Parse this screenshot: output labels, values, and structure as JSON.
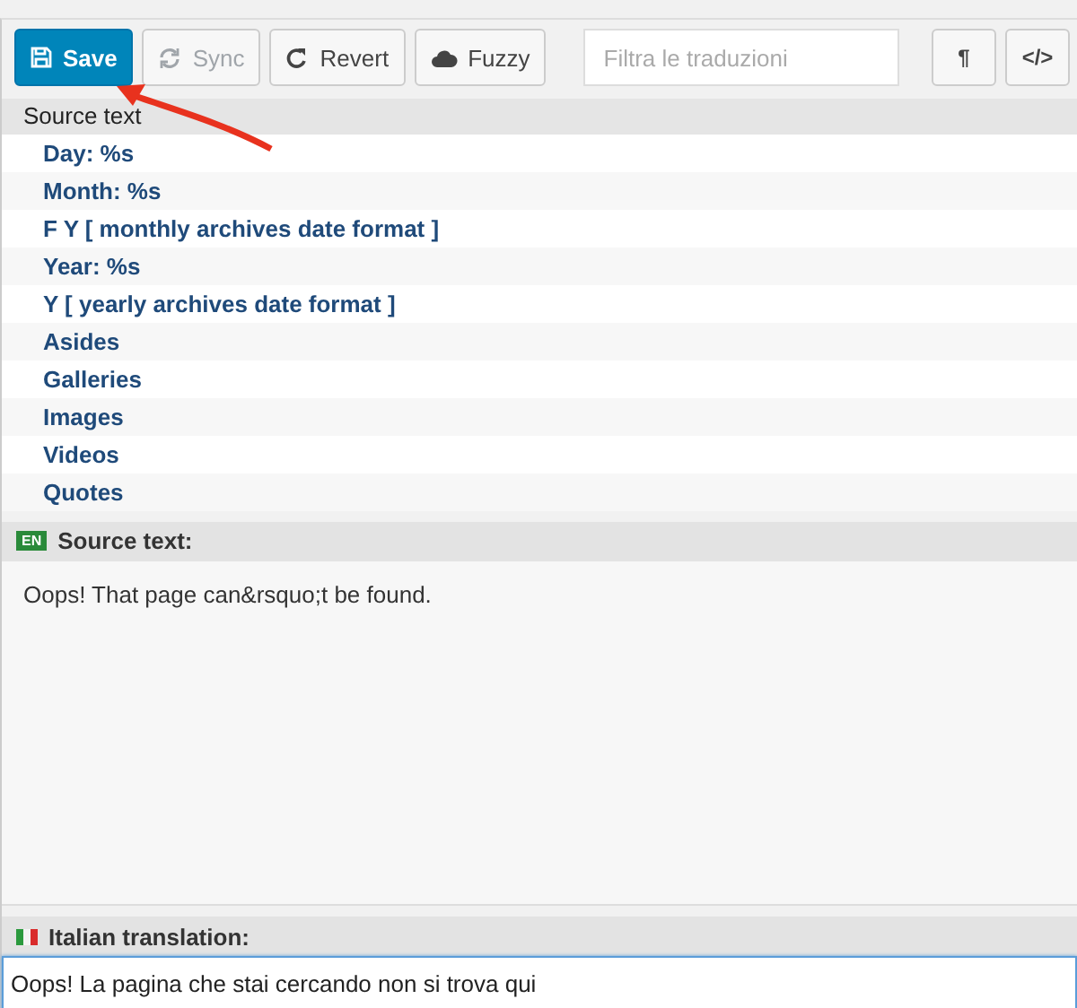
{
  "toolbar": {
    "buttons": [
      {
        "label": "Save",
        "kind": "primary",
        "disabled": false
      },
      {
        "label": "Sync",
        "kind": "default",
        "disabled": true
      },
      {
        "label": "Revert",
        "kind": "default",
        "disabled": false
      },
      {
        "label": "Fuzzy",
        "kind": "default",
        "disabled": false
      }
    ],
    "filter": {
      "placeholder": "Filtra le traduzioni"
    },
    "tools": [
      "¶",
      "</>"
    ]
  },
  "list": {
    "header": "Source text",
    "rows": [
      {
        "text": "Day: %s",
        "selected": false
      },
      {
        "text": "Month: %s",
        "selected": false
      },
      {
        "text": "F Y [ monthly archives date format ]",
        "selected": false
      },
      {
        "text": "Year: %s",
        "selected": false
      },
      {
        "text": "Y [ yearly archives date format ]",
        "selected": false
      },
      {
        "text": "Asides",
        "selected": false
      },
      {
        "text": "Galleries",
        "selected": false
      },
      {
        "text": "Images",
        "selected": false
      },
      {
        "text": "Videos",
        "selected": false
      },
      {
        "text": "Quotes",
        "selected": false
      }
    ]
  },
  "source": {
    "badge": "EN",
    "label": "Source text:",
    "text": "Oops! That page can&rsquo;t be found."
  },
  "translation": {
    "label": "Italian translation:",
    "value": "Oops! La pagina che stai cercando non si trova qui"
  }
}
